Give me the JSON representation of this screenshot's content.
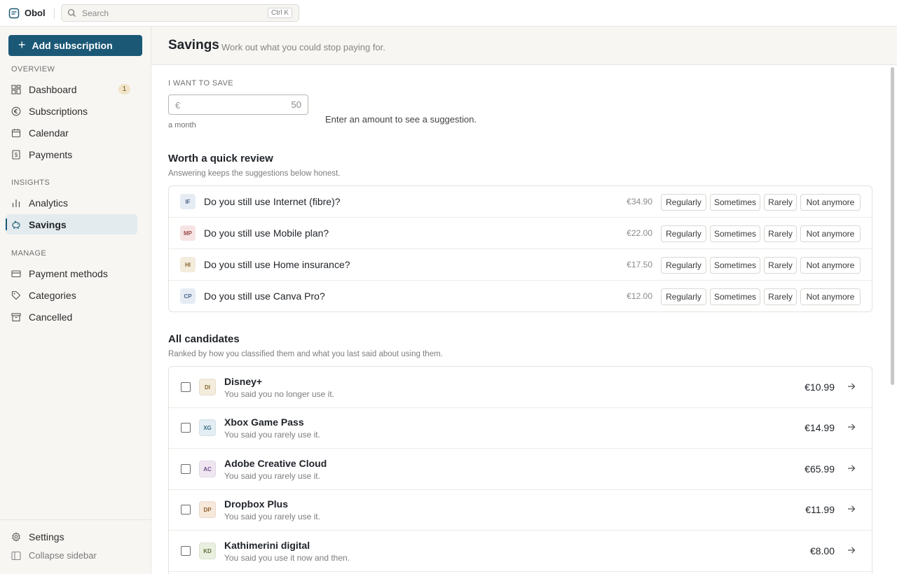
{
  "app": {
    "name": "Obol"
  },
  "search": {
    "placeholder": "Search",
    "shortcut": "Ctrl K"
  },
  "sidebar": {
    "add_button": "Add subscription",
    "sections": {
      "overview": "OVERVIEW",
      "insights": "INSIGHTS",
      "manage": "MANAGE"
    },
    "items": {
      "dashboard": {
        "label": "Dashboard",
        "badge": "1",
        "icon": "dashboard-icon"
      },
      "subscriptions": {
        "label": "Subscriptions",
        "icon": "euro-circle-icon"
      },
      "calendar": {
        "label": "Calendar",
        "icon": "calendar-icon"
      },
      "payments": {
        "label": "Payments",
        "icon": "dollar-receipt-icon"
      },
      "analytics": {
        "label": "Analytics",
        "icon": "bar-chart-icon"
      },
      "savings": {
        "label": "Savings",
        "icon": "piggy-bank-icon",
        "active": true
      },
      "payment_methods": {
        "label": "Payment methods",
        "icon": "credit-card-icon"
      },
      "categories": {
        "label": "Categories",
        "icon": "tag-icon"
      },
      "cancelled": {
        "label": "Cancelled",
        "icon": "archive-icon"
      }
    },
    "settings": "Settings",
    "collapse": "Collapse sidebar"
  },
  "header": {
    "title": "Savings",
    "subtitle": "Work out what you could stop paying for."
  },
  "saving_goal": {
    "label": "I WANT TO SAVE",
    "currency": "€",
    "placeholder": "50",
    "value": "",
    "period": "a month",
    "hint": "Enter an amount to see a suggestion."
  },
  "review": {
    "title": "Worth a quick review",
    "subtitle": "Answering keeps the suggestions below honest.",
    "options": [
      "Regularly",
      "Sometimes",
      "Rarely",
      "Not anymore"
    ],
    "items": [
      {
        "initials": "IF",
        "question": "Do you still use Internet (fibre)?",
        "price": "€34.90",
        "bg": "#e6ecf4",
        "fg": "#4a6488"
      },
      {
        "initials": "MP",
        "question": "Do you still use Mobile plan?",
        "price": "€22.00",
        "bg": "#f6e4e4",
        "fg": "#9a4a4a"
      },
      {
        "initials": "HI",
        "question": "Do you still use Home insurance?",
        "price": "€17.50",
        "bg": "#f4ecdc",
        "fg": "#866a36"
      },
      {
        "initials": "CP",
        "question": "Do you still use Canva Pro?",
        "price": "€12.00",
        "bg": "#e6ecf4",
        "fg": "#4a6488"
      }
    ]
  },
  "candidates": {
    "title": "All candidates",
    "subtitle": "Ranked by how you classified them and what you last said about using them.",
    "items": [
      {
        "initials": "DI",
        "name": "Disney+",
        "note": "You said you no longer use it.",
        "price": "€10.99",
        "bg": "#f4ecdc",
        "fg": "#866a36"
      },
      {
        "initials": "XG",
        "name": "Xbox Game Pass",
        "note": "You said you rarely use it.",
        "price": "€14.99",
        "bg": "#e2eef4",
        "fg": "#3f6d86"
      },
      {
        "initials": "AC",
        "name": "Adobe Creative Cloud",
        "note": "You said you rarely use it.",
        "price": "€65.99",
        "bg": "#efe6f2",
        "fg": "#74518a"
      },
      {
        "initials": "DP",
        "name": "Dropbox Plus",
        "note": "You said you rarely use it.",
        "price": "€11.99",
        "bg": "#f6e8da",
        "fg": "#925f2e"
      },
      {
        "initials": "KD",
        "name": "Kathimerini digital",
        "note": "You said you use it now and then.",
        "price": "€8.00",
        "bg": "#eaf0e0",
        "fg": "#5b6f3a"
      }
    ]
  },
  "colors": {
    "accent": "#1b5876",
    "sidebar_bg": "#f7f6f3",
    "active_bg": "#e4ebee",
    "badge_bg": "#f1e4c8"
  }
}
